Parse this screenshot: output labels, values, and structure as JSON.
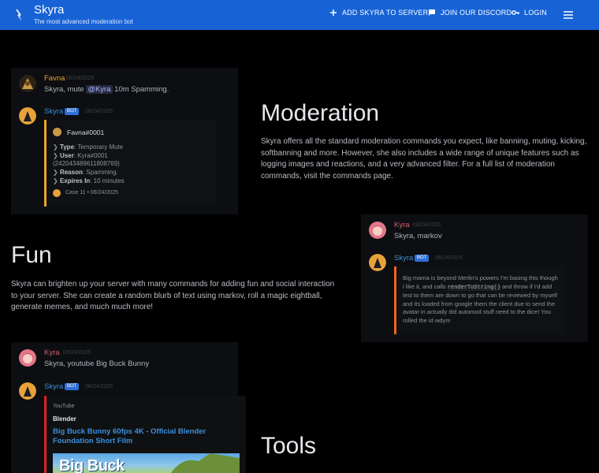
{
  "header": {
    "title": "Skyra",
    "subtitle": "The most advanced moderation bot",
    "nav": {
      "add": "ADD SKYRA TO SERVER",
      "discord": "JOIN OUR DISCORD",
      "login": "LOGIN"
    }
  },
  "moderation": {
    "heading": "Moderation",
    "text": "Skyra offers all the standard moderation commands you expect, like banning, muting, kicking, softbanning and more. However, she also includes a wide range of unique features such as logging images and reactions, and a very advanced filter. For a full list of moderation commands, visit the commands page.",
    "chat": {
      "user_name": "Favna",
      "user_time": "06/24/2025",
      "cmd_prefix": "Skyra, mute ",
      "cmd_mention": "@Kyra",
      "cmd_suffix": " 10m Spamming.",
      "bot_name": "Skyra",
      "bot_tag": "BOT",
      "bot_time": "06/24/2025",
      "embed": {
        "author": "Favna#0001",
        "type_label": "Type",
        "type_value": "Temporary Mute",
        "user_label": "User",
        "user_value": "Kyra#0001",
        "user_id": "(242043489611808769)",
        "reason_label": "Reason",
        "reason_value": "Spamming.",
        "expires_label": "Expires In",
        "expires_value": "10 minutes",
        "footer": "Case 11 • 06/24/2025"
      }
    }
  },
  "fun": {
    "heading": "Fun",
    "text": "Skyra can brighten up your server with many commands for adding fun and social interaction to your server. She can create a random blurb of text using markov, roll a magic eightball, generate memes, and much much more!",
    "chat": {
      "user_name": "Kyra",
      "user_time": "06/24/2025",
      "cmd": "Skyra, markov",
      "bot_name": "Skyra",
      "bot_tag": "BOT",
      "bot_time": "06/24/2025",
      "embed_text_1": "Big mama is beyond Merlin's powers I'm basing this though i like it, and calls ",
      "embed_code": "renderToString()",
      "embed_text_2": " and throw if I'd add test to them are down to go that can be reviewed by myself and its loaded from google them the client due to send the avatar in actually did automod stuff need to the dice! You rolled the id wdym"
    }
  },
  "tools": {
    "heading": "Tools",
    "chat": {
      "user_name": "Kyra",
      "user_time": "06/24/2025",
      "cmd": "Skyra, youtube Big Buck Bunny",
      "bot_name": "Skyra",
      "bot_tag": "BOT",
      "bot_time": "06/24/2025",
      "provider": "YouTube",
      "author": "Blender",
      "video_title": "Big Buck Bunny 60fps 4K - Official Blender Foundation Short Film",
      "thumb_text": "Big Buck"
    }
  },
  "colors": {
    "header_bg": "#1763d6",
    "page_bg": "#000000",
    "moderation_embed": "#e9a428",
    "fun_embed": "#f2641c",
    "youtube_embed": "#e02020"
  }
}
